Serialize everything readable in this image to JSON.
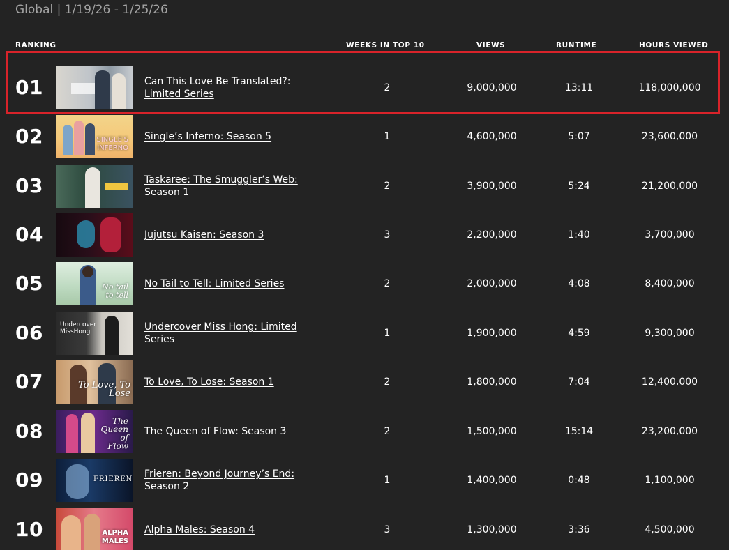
{
  "header": {
    "subtitle": "Global | 1/19/26 - 1/25/26"
  },
  "columns": {
    "ranking": "RANKING",
    "weeks": "WEEKS IN TOP 10",
    "views": "VIEWS",
    "runtime": "RUNTIME",
    "hours": "HOURS VIEWED"
  },
  "colors": {
    "highlight": "#d8232a",
    "background": "#232323"
  },
  "rows": [
    {
      "rank": "01",
      "title": "Can This Love Be Translated?: Limited Series",
      "weeks": "2",
      "views": "9,000,000",
      "runtime": "13:11",
      "hours": "118,000,000",
      "thumb_text": ""
    },
    {
      "rank": "02",
      "title": "Single’s Inferno: Season 5",
      "weeks": "1",
      "views": "4,600,000",
      "runtime": "5:07",
      "hours": "23,600,000",
      "thumb_text": "SINGLE'S INFERNO"
    },
    {
      "rank": "03",
      "title": "Taskaree: The Smuggler’s Web: Season 1",
      "weeks": "2",
      "views": "3,900,000",
      "runtime": "5:24",
      "hours": "21,200,000",
      "thumb_text": ""
    },
    {
      "rank": "04",
      "title": "Jujutsu Kaisen: Season 3",
      "weeks": "3",
      "views": "2,200,000",
      "runtime": "1:40",
      "hours": "3,700,000",
      "thumb_text": ""
    },
    {
      "rank": "05",
      "title": "No Tail to Tell: Limited Series",
      "weeks": "2",
      "views": "2,000,000",
      "runtime": "4:08",
      "hours": "8,400,000",
      "thumb_text": "No tail to tell"
    },
    {
      "rank": "06",
      "title": "Undercover Miss Hong: Limited Series",
      "weeks": "1",
      "views": "1,900,000",
      "runtime": "4:59",
      "hours": "9,300,000",
      "thumb_text": "Undercover MissHong"
    },
    {
      "rank": "07",
      "title": "To Love, To Lose: Season 1",
      "weeks": "2",
      "views": "1,800,000",
      "runtime": "7:04",
      "hours": "12,400,000",
      "thumb_text": "To Love, To Lose"
    },
    {
      "rank": "08",
      "title": "The Queen of Flow: Season 3",
      "weeks": "2",
      "views": "1,500,000",
      "runtime": "15:14",
      "hours": "23,200,000",
      "thumb_text": "The Queen of Flow"
    },
    {
      "rank": "09",
      "title": "Frieren: Beyond Journey’s End: Season 2",
      "weeks": "1",
      "views": "1,400,000",
      "runtime": "0:48",
      "hours": "1,100,000",
      "thumb_text": "FRIEREN"
    },
    {
      "rank": "10",
      "title": "Alpha Males: Season 4",
      "weeks": "3",
      "views": "1,300,000",
      "runtime": "3:36",
      "hours": "4,500,000",
      "thumb_text": "ALPHA MALES"
    }
  ]
}
